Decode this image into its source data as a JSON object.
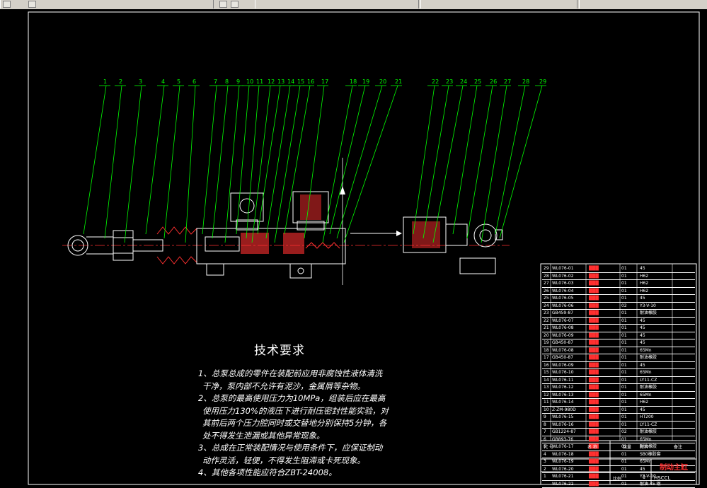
{
  "tech_requirements": {
    "title": "技术要求",
    "lines": [
      "1、总泵总成的零件在装配前应用非腐蚀性液体清洗",
      "干净，泵内部不允许有泥沙，金属屑等杂物。",
      "2、总泵的最高使用压力为10MPa，组装后应在最高",
      "使用压力130%的液压下进行耐压密封性能实验，对",
      "其前后两个压力腔同时或交替地分别保持5分钟，各",
      "处不得发生泄漏或其他异常现象。",
      "3、总成在正常装配情况与使用条件下，应保证制动",
      "动作灵活，轻便，不得发生阻滞或卡死现象。",
      "4、其他各项性能应符合ZBT-24008。"
    ]
  },
  "leader_numbers": [
    "1",
    "2",
    "3",
    "4",
    "5",
    "6",
    "7",
    "8",
    "9",
    "10",
    "11",
    "12",
    "13",
    "14",
    "15",
    "16",
    "17",
    "18",
    "19",
    "20",
    "21",
    "22",
    "23",
    "24",
    "25",
    "26",
    "27",
    "28",
    "29"
  ],
  "bom_rows": [
    {
      "no": "29",
      "code": "WL076-01",
      "qty": "01",
      "mat": "45"
    },
    {
      "no": "28",
      "code": "WL076-02",
      "qty": "01",
      "mat": "H62"
    },
    {
      "no": "27",
      "code": "WL076-03",
      "qty": "01",
      "mat": "H62"
    },
    {
      "no": "26",
      "code": "WL076-04",
      "qty": "01",
      "mat": "H62"
    },
    {
      "no": "25",
      "code": "WL076-05",
      "qty": "01",
      "mat": "45"
    },
    {
      "no": "24",
      "code": "WL076-06",
      "qty": "02",
      "mat": "Y3-V-10"
    },
    {
      "no": "23",
      "code": "GB459-87",
      "qty": "01",
      "mat": "耐油橡胶"
    },
    {
      "no": "22",
      "code": "WL076-07",
      "qty": "01",
      "mat": "45"
    },
    {
      "no": "21",
      "code": "WL076-08",
      "qty": "01",
      "mat": "45"
    },
    {
      "no": "20",
      "code": "WL076-09",
      "qty": "01",
      "mat": "45"
    },
    {
      "no": "19",
      "code": "GB450-87",
      "qty": "01",
      "mat": "45"
    },
    {
      "no": "18",
      "code": "WL076-08",
      "qty": "01",
      "mat": "65Mn"
    },
    {
      "no": "17",
      "code": "GB450-87",
      "qty": "01",
      "mat": "耐油橡胶"
    },
    {
      "no": "16",
      "code": "WL076-09",
      "qty": "01",
      "mat": "45"
    },
    {
      "no": "15",
      "code": "WL076-10",
      "qty": "01",
      "mat": "65Mn"
    },
    {
      "no": "14",
      "code": "WL076-11",
      "qty": "01",
      "mat": "LY11-CZ"
    },
    {
      "no": "13",
      "code": "WL076-12",
      "qty": "01",
      "mat": "耐油橡胶"
    },
    {
      "no": "12",
      "code": "WL076-13",
      "qty": "01",
      "mat": "65Mn"
    },
    {
      "no": "11",
      "code": "WL076-14",
      "qty": "01",
      "mat": "H62"
    },
    {
      "no": "10",
      "code": "Z-ZM-980D",
      "qty": "01",
      "mat": "45"
    },
    {
      "no": "9",
      "code": "WL076-15",
      "qty": "01",
      "mat": "HT200"
    },
    {
      "no": "8",
      "code": "WL076-16",
      "qty": "01",
      "mat": "LY11-CZ"
    },
    {
      "no": "7",
      "code": "GB1224-87",
      "qty": "02",
      "mat": "耐油橡胶"
    },
    {
      "no": "6",
      "code": "GB893-76",
      "qty": "01",
      "mat": "65Mn"
    },
    {
      "no": "5",
      "code": "WL076-17",
      "qty": "01",
      "mat": "耐油橡胶"
    },
    {
      "no": "4",
      "code": "WL076-18",
      "qty": "01",
      "mat": "SB0橡胶套"
    },
    {
      "no": "3",
      "code": "WL076-19",
      "qty": "01",
      "mat": "65Mn"
    },
    {
      "no": "2",
      "code": "WL076-20",
      "qty": "01",
      "mat": "45"
    },
    {
      "no": "1",
      "code": "WL076-21",
      "qty": "01",
      "mat": "Y3-V-10"
    },
    {
      "no": "",
      "code": "WL076-22",
      "qty": "01",
      "mat": "耐油 45 钢"
    }
  ],
  "title_block": {
    "drawing_name": "制动主缸",
    "school": "HSCCL",
    "scale_label": "比例",
    "sheet": "6",
    "header_labels": [
      "代",
      "号",
      "名",
      "称",
      "数",
      "量",
      "材",
      "料",
      "备注"
    ]
  }
}
